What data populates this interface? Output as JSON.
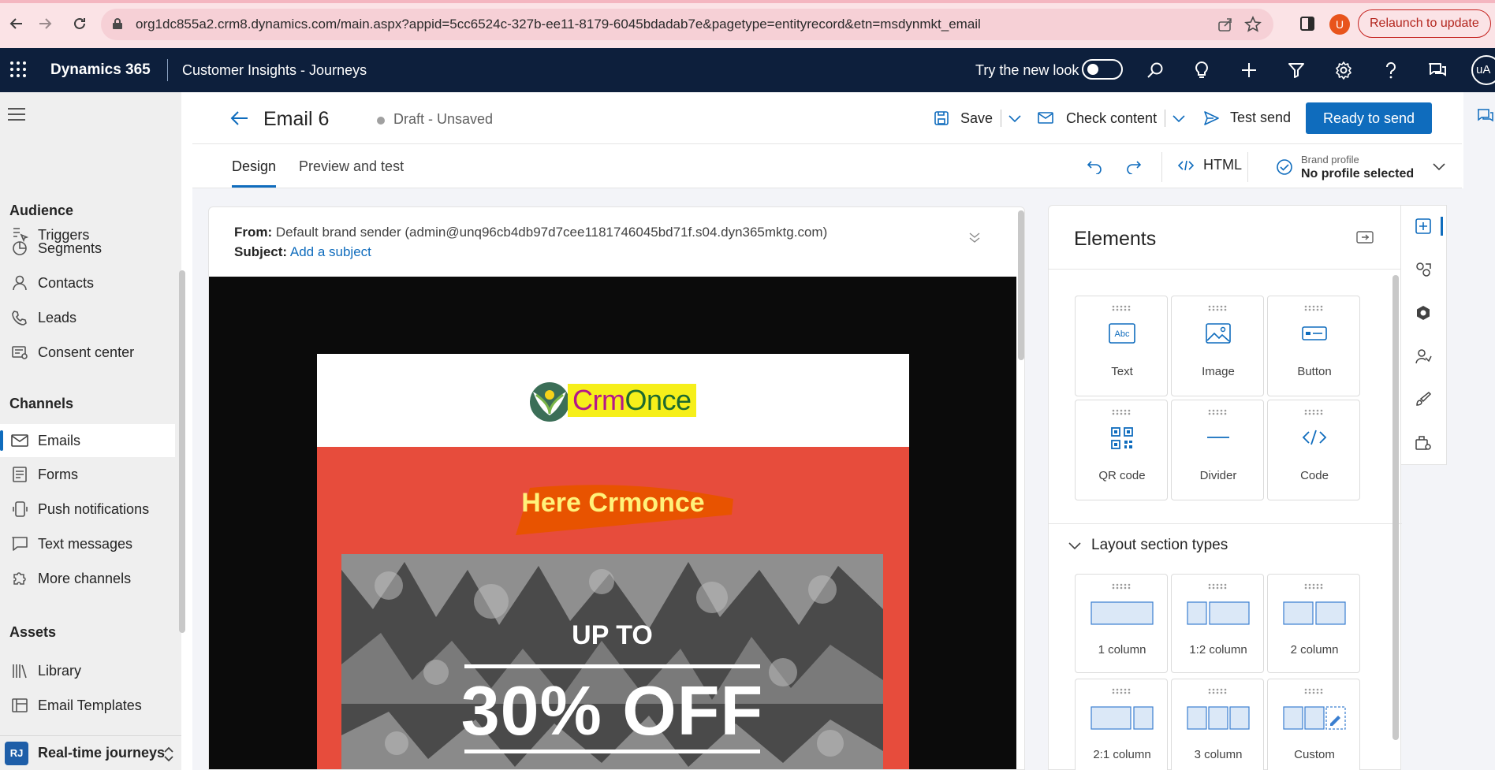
{
  "browser": {
    "url": "org1dc855a2.crm8.dynamics.com/main.aspx?appid=5cc6524c-327b-ee11-8179-6045bdadab7e&pagetype=entityrecord&etn=msdynmkt_email",
    "profile_initial": "U",
    "relaunch_label": "Relaunch to update"
  },
  "header": {
    "product": "Dynamics 365",
    "app_name": "Customer Insights - Journeys",
    "try_new_look": "Try the new look",
    "user_initials": "uA"
  },
  "sidebar": {
    "top_item": "Triggers",
    "sections": [
      {
        "title": "Audience",
        "items": [
          "Segments",
          "Contacts",
          "Leads",
          "Consent center"
        ]
      },
      {
        "title": "Channels",
        "items": [
          "Emails",
          "Forms",
          "Push notifications",
          "Text messages",
          "More channels"
        ]
      },
      {
        "title": "Assets",
        "items": [
          "Library",
          "Email Templates"
        ]
      }
    ],
    "active_item": "Emails",
    "area": {
      "badge": "RJ",
      "label": "Real-time journeys"
    }
  },
  "record": {
    "title": "Email 6",
    "status": "Draft - Unsaved"
  },
  "commands": {
    "save": "Save",
    "check_content": "Check content",
    "test_send": "Test send",
    "ready_to_send": "Ready to send"
  },
  "tabs": {
    "design": "Design",
    "preview": "Preview and test",
    "selected": "Design"
  },
  "toolbar": {
    "html": "HTML",
    "brand_profile_label": "Brand profile",
    "brand_profile_value": "No profile selected"
  },
  "email": {
    "from_label": "From:",
    "from_value": "Default brand sender (admin@unq96cb4db97d7cee1181746045bd71f.s04.dyn365mktg.com)",
    "subject_label": "Subject:",
    "subject_link": "Add a subject",
    "logo_prefix": "Crm",
    "logo_suffix": "Once",
    "headline": "Here Crmonce",
    "up_to": "UP TO",
    "offer": "30% OFF"
  },
  "elements_panel": {
    "title": "Elements",
    "elements": [
      "Text",
      "Image",
      "Button",
      "QR code",
      "Divider",
      "Code"
    ],
    "layout_title": "Layout section types",
    "layouts": [
      "1 column",
      "1:2 column",
      "2 column",
      "2:1 column",
      "3 column",
      "Custom"
    ]
  },
  "colors": {
    "accent": "#0f6cbd",
    "header_bg": "#0d1f3c",
    "email_red": "#e74c3c",
    "logo_highlight": "#f6ef1a"
  }
}
